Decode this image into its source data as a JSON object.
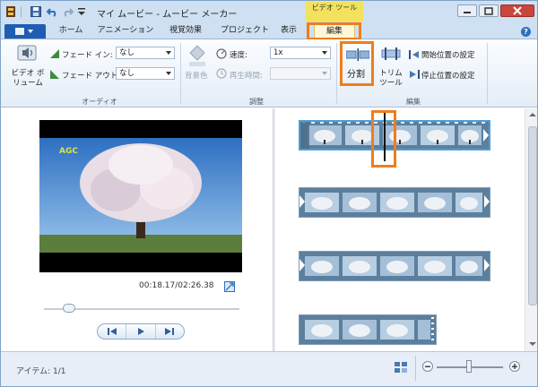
{
  "app": {
    "title": "マイ ムービー - ムービー メーカー",
    "context_tab_group": "ビデオ ツール"
  },
  "tabs": {
    "home": "ホーム",
    "animation": "アニメーション",
    "visual_effects": "視覚効果",
    "project": "プロジェクト",
    "view": "表示",
    "edit": "編集"
  },
  "ribbon": {
    "audio": {
      "video_volume": "ビデオ ボリューム",
      "fade_in_label": "フェード イン:",
      "fade_in_value": "なし",
      "fade_out_label": "フェード アウト:",
      "fade_out_value": "なし",
      "group_label": "オーディオ"
    },
    "adjust": {
      "bg_color": "背景色",
      "speed_label": "速度:",
      "speed_value": "1x",
      "duration_label": "再生時間:",
      "duration_value": "",
      "group_label": "調整"
    },
    "edit": {
      "split": "分割",
      "trim_tool": "トリム ツール",
      "set_start": "開始位置の設定",
      "set_end": "停止位置の設定",
      "group_label": "編集"
    }
  },
  "preview": {
    "watermark": "AGC",
    "time": "00:18.17/02:26.38",
    "seek_fraction": 0.13
  },
  "status": {
    "items": "アイテム: 1/1",
    "zoom_fraction": 0.48
  },
  "colors": {
    "highlight": "#f07d1c",
    "accent": "#1e5db3",
    "context_tab": "#f2e25d"
  }
}
